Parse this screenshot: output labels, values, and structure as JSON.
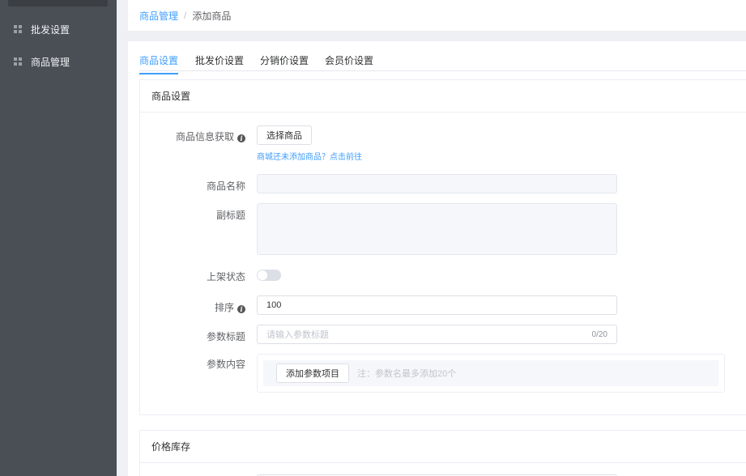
{
  "sidebar": {
    "items": [
      {
        "label": "批发设置",
        "icon": "grid-icon"
      },
      {
        "label": "商品管理",
        "icon": "grid-icon"
      }
    ]
  },
  "breadcrumb": {
    "parent": "商品管理",
    "separator": "/",
    "current": "添加商品"
  },
  "tabs": [
    {
      "label": "商品设置",
      "active": true
    },
    {
      "label": "批发价设置",
      "active": false
    },
    {
      "label": "分销价设置",
      "active": false
    },
    {
      "label": "会员价设置",
      "active": false
    }
  ],
  "goods_section": {
    "title": "商品设置",
    "fetch_label": "商品信息获取",
    "fetch_button": "选择商品",
    "fetch_hint": "商城还未添加商品？点击前往",
    "name_label": "商品名称",
    "name_value": "",
    "subtitle_label": "副标题",
    "subtitle_value": "",
    "status_label": "上架状态",
    "status_on": false,
    "sort_label": "排序",
    "sort_value": "100",
    "param_title_label": "参数标题",
    "param_title_placeholder": "请输入参数标题",
    "param_title_counter": "0/20",
    "param_content_label": "参数内容",
    "add_param_button": "添加参数项目",
    "param_note": "注：参数名最多添加20个"
  },
  "price_section": {
    "title": "价格库存"
  },
  "colors": {
    "accent": "#409eff",
    "sidebar_bg": "#4a4f55"
  }
}
